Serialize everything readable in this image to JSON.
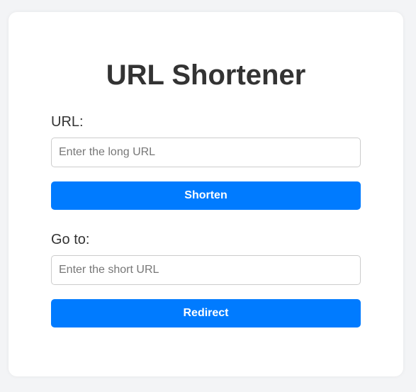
{
  "title": "URL Shortener",
  "shorten_section": {
    "label": "URL:",
    "input_placeholder": "Enter the long URL",
    "input_value": "",
    "button_label": "Shorten"
  },
  "redirect_section": {
    "label": "Go to:",
    "input_placeholder": "Enter the short URL",
    "input_value": "",
    "button_label": "Redirect"
  },
  "colors": {
    "page_background": "#f3f4f6",
    "card_background": "#ffffff",
    "button_background": "#007bff",
    "text": "#333333"
  }
}
